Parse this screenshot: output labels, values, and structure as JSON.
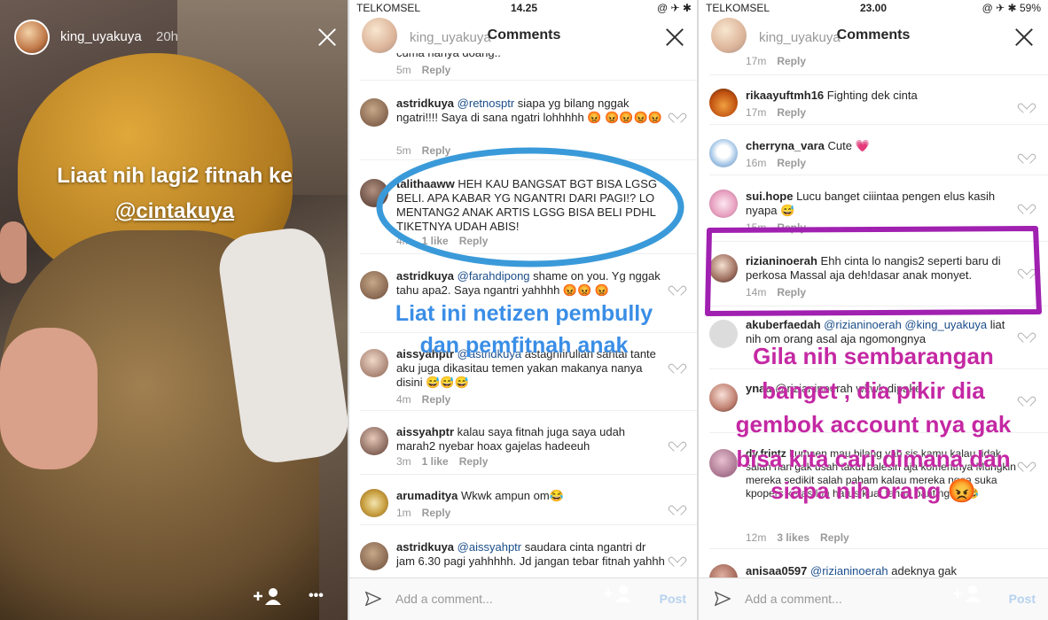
{
  "story": {
    "username": "king_uyakuya",
    "time": "20h",
    "caption_line1": "Liaat nih lagi2 fitnah ke",
    "caption_mention": "@cintakuya",
    "add_person": "+",
    "more": "•••"
  },
  "screen2": {
    "carrier": "TELKOMSEL",
    "clock": "14.25",
    "status_right": "@ ✈ ✱",
    "ghost_user": "king_uyakuya",
    "title": "Comments",
    "overlay_line1": "Liat ini netizen pembully",
    "overlay_line2": "dan pemfitnah anak",
    "comments": [
      {
        "user": "",
        "text": "cuma nanya doang..",
        "time": "5m",
        "likes": "",
        "reply": "Reply"
      },
      {
        "user": "astridkuya",
        "mention": "@retnosptr",
        "text": " siapa yg bilang nggak ngatri!!!! Saya di sana ngatri lohhhhh 😡 😡😡😡😡",
        "time": "5m",
        "likes": "",
        "reply": "Reply"
      },
      {
        "user": "talithaaww",
        "text": "HEH KAU BANGSAT BGT BISA LGSG BELI. APA KABAR YG NGANTRI DARI PAGI!? LO MENTANG2 ANAK ARTIS LGSG BISA BELI PDHL TIKETNYA UDAH ABIS!",
        "time": "4m",
        "likes": "1 like",
        "reply": "Reply"
      },
      {
        "user": "astridkuya",
        "mention": "@farahdipong",
        "text": " shame on you. Yg nggak tahu apa2. Saya ngantri yahhhh 😡😡 😡",
        "time": "4m",
        "likes": "",
        "reply": "Reply"
      },
      {
        "user": "aissyahptr",
        "mention": "@astridkuya",
        "text": " astaghfirullah santai tante aku juga dikasitau temen yakan makanya nanya disini 😅😅😅",
        "time": "4m",
        "likes": "",
        "reply": "Reply"
      },
      {
        "user": "aissyahptr",
        "text": "kalau saya fitnah juga saya udah marah2 nyebar hoax gajelas hadeeuh",
        "time": "3m",
        "likes": "1 like",
        "reply": "Reply"
      },
      {
        "user": "arumaditya",
        "text": "Wkwk ampun om😂",
        "time": "1m",
        "likes": "",
        "reply": "Reply"
      },
      {
        "user": "astridkuya",
        "mention": "@aissyahptr",
        "text": " saudara cinta ngantri dr jam 6.30 pagi yahhhhh. Jd jangan tebar fitnah yahhh",
        "time": "",
        "likes": "",
        "reply": ""
      }
    ],
    "input_placeholder": "Add a comment...",
    "post_label": "Post",
    "add_person": "+"
  },
  "screen3": {
    "carrier": "TELKOMSEL",
    "clock": "23.00",
    "battery": "59%",
    "status_right": "@ ✈ ✱",
    "ghost_user": "king_uyakuya",
    "title": "Comments",
    "overlay_line1": "Gila nih sembarangan",
    "overlay_line2": "banget , dia pikir dia",
    "overlay_line3": "gembok account nya gak",
    "overlay_line4": "bisa kita cari dimana dan",
    "overlay_line5": "siapa nih orang 😡",
    "comments": [
      {
        "user": "",
        "text": "",
        "time": "17m",
        "likes": "",
        "reply": "Reply"
      },
      {
        "user": "rikaayuftmh16",
        "text": "Fighting dek cinta",
        "time": "17m",
        "likes": "",
        "reply": "Reply"
      },
      {
        "user": "cherryna_vara",
        "text": "Cute 💗",
        "time": "16m",
        "likes": "",
        "reply": "Reply"
      },
      {
        "user": "sui.hope",
        "text": "Lucu banget ciiintaa pengen elus kasih nyapa 😅",
        "time": "15m",
        "likes": "",
        "reply": "Reply"
      },
      {
        "user": "rizianinoerah",
        "text": "Ehh cinta lo nangis2 seperti baru di perkosa Massal aja deh!dasar anak monyet.",
        "time": "14m",
        "likes": "",
        "reply": "Reply"
      },
      {
        "user": "akuberfaedah",
        "mention": "@rizianinoerah @king_uyakuya",
        "text": " liat nih om orang asal aja ngomongnya",
        "time": "",
        "likes": "",
        "reply": ""
      },
      {
        "user": "ynaa",
        "text": "@rizianinoerah wkwk dipake",
        "time": "",
        "likes": "",
        "reply": ""
      },
      {
        "user": "dy.frintz",
        "text": "kumaen mau bilang yah sis kamu kalau tidak salah nan gak usah takut balesin aja komentnya Mungkin mereka sedikit salah paham kalau mereka ngga suka kpopers keras loh harus kuat tahan banting❤️ 😂",
        "time": "12m",
        "likes": "3 likes",
        "reply": "Reply"
      },
      {
        "user": "anisaa0597",
        "mention": "@rizianinoerah",
        "text": " adeknya gak",
        "time": "",
        "likes": "",
        "reply": ""
      }
    ],
    "input_placeholder": "Add a comment...",
    "post_label": "Post",
    "add_person": "+"
  },
  "colors": {
    "blue_circle": "#3a9ad9",
    "magenta_box": "#a020b0",
    "mention": "#1a4d8a",
    "post": "#b7d2ee"
  }
}
